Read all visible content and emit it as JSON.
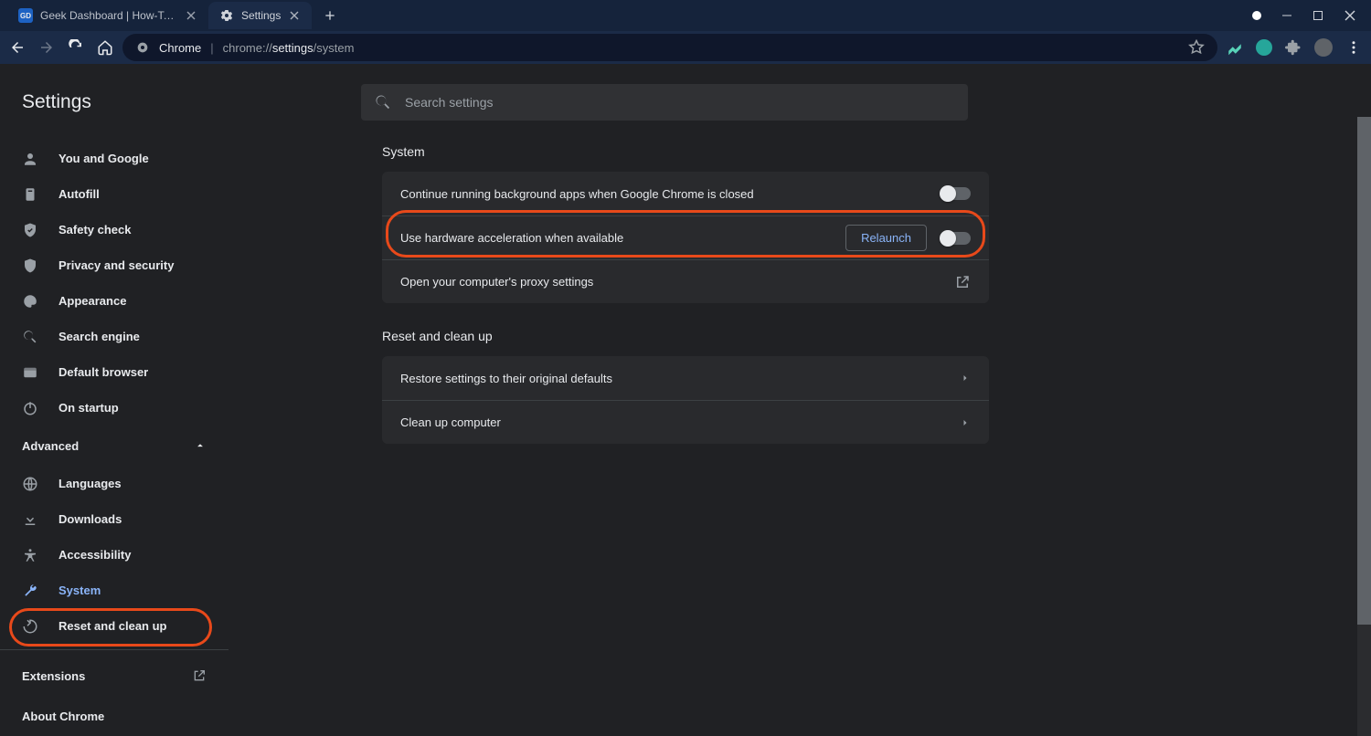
{
  "titlebar": {
    "tabs": [
      {
        "title": "Geek Dashboard | How-To's, Sm",
        "favicon_bg": "#1e69d2",
        "favicon_text": "GD"
      },
      {
        "title": "Settings"
      }
    ]
  },
  "addressbar": {
    "origin_label": "Chrome",
    "url_prefix": "chrome://",
    "url_mid": "settings",
    "url_suffix": "/system"
  },
  "settings": {
    "title": "Settings",
    "search_placeholder": "Search settings"
  },
  "sidebar": {
    "items": [
      {
        "label": "You and Google",
        "icon": "person"
      },
      {
        "label": "Autofill",
        "icon": "autofill"
      },
      {
        "label": "Safety check",
        "icon": "shield-check"
      },
      {
        "label": "Privacy and security",
        "icon": "shield"
      },
      {
        "label": "Appearance",
        "icon": "palette"
      },
      {
        "label": "Search engine",
        "icon": "search"
      },
      {
        "label": "Default browser",
        "icon": "browser"
      },
      {
        "label": "On startup",
        "icon": "power"
      }
    ],
    "advanced_label": "Advanced",
    "advanced_items": [
      {
        "label": "Languages",
        "icon": "globe"
      },
      {
        "label": "Downloads",
        "icon": "download"
      },
      {
        "label": "Accessibility",
        "icon": "accessibility"
      },
      {
        "label": "System",
        "icon": "wrench",
        "selected": true
      },
      {
        "label": "Reset and clean up",
        "icon": "restore"
      }
    ],
    "extensions_label": "Extensions",
    "about_label": "About Chrome"
  },
  "panel": {
    "system_heading": "System",
    "system_rows": {
      "bg_apps": "Continue running background apps when Google Chrome is closed",
      "hw_accel": "Use hardware acceleration when available",
      "relaunch": "Relaunch",
      "proxy": "Open your computer's proxy settings"
    },
    "reset_heading": "Reset and clean up",
    "reset_rows": {
      "restore": "Restore settings to their original defaults",
      "cleanup": "Clean up computer"
    }
  }
}
